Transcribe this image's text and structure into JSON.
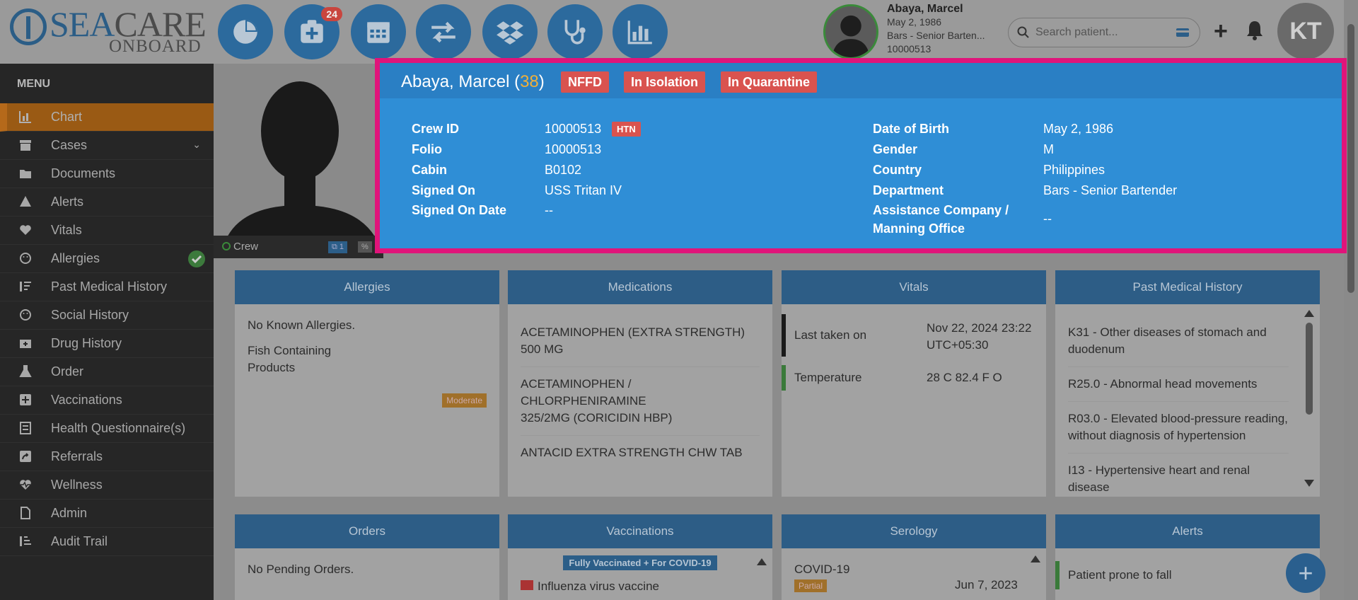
{
  "logo": {
    "sea": "SEA",
    "care": "CARE",
    "onboard": "ONBOARD"
  },
  "nav": {
    "badge_count": "24"
  },
  "patient_top": {
    "name": "Abaya, Marcel",
    "dob": "May 2, 1986",
    "dept": "Bars - Senior Barten...",
    "id": "10000513"
  },
  "search": {
    "placeholder": "Search patient..."
  },
  "user": {
    "initials": "KT"
  },
  "menu": {
    "header": "MENU",
    "items": [
      "Chart",
      "Cases",
      "Documents",
      "Alerts",
      "Vitals",
      "Allergies",
      "Past Medical History",
      "Social History",
      "Drug History",
      "Order",
      "Vaccinations",
      "Health Questionnaire(s)",
      "Referrals",
      "Wellness",
      "Admin",
      "Audit Trail"
    ]
  },
  "photo": {
    "status": "Crew",
    "count": "1"
  },
  "summary": {
    "name": "Abaya, Marcel (",
    "age": "38",
    "close": ")",
    "tags": [
      "NFFD",
      "In Isolation",
      "In Quarantine"
    ],
    "left": [
      {
        "label": "Crew ID",
        "value": "10000513"
      },
      {
        "label": "Folio",
        "value": "10000513"
      },
      {
        "label": "Cabin",
        "value": "B0102"
      },
      {
        "label": "Signed On",
        "value": "USS Tritan IV"
      },
      {
        "label": "Signed On Date",
        "value": "--"
      }
    ],
    "htn": "HTN",
    "right": [
      {
        "label": "Date of Birth",
        "value": "May 2, 1986"
      },
      {
        "label": "Gender",
        "value": "M"
      },
      {
        "label": "Country",
        "value": "Philippines"
      },
      {
        "label": "Department",
        "value": "Bars - Senior Bartender"
      },
      {
        "label": "Assistance Company /",
        "label2": "Manning Office",
        "value": "--"
      }
    ]
  },
  "cards": {
    "allergies": {
      "title": "Allergies",
      "none": "No Known Allergies.",
      "item1": "Fish Containing",
      "item2": "Products",
      "severity": "Moderate"
    },
    "medications": {
      "title": "Medications",
      "m1a": "ACETAMINOPHEN (EXTRA STRENGTH)",
      "m1b": "500 MG",
      "m2a": "ACETAMINOPHEN / CHLORPHENIRAMINE",
      "m2b": "325/2MG (CORICIDIN HBP)",
      "m3": "ANTACID EXTRA STRENGTH CHW TAB"
    },
    "vitals": {
      "title": "Vitals",
      "last_label": "Last taken on",
      "last_value1": "Nov 22, 2024 23:22",
      "last_value2": "UTC+05:30",
      "temp_label": "Temperature",
      "temp_value": "28 C    82.4 F    O"
    },
    "pmh": {
      "title": "Past Medical History",
      "i1a": "K31 - Other diseases of stomach and",
      "i1b": "duodenum",
      "i2": "R25.0 - Abnormal head movements",
      "i3a": "R03.0 - Elevated blood-pressure reading,",
      "i3b": "without diagnosis of hypertension",
      "i4a": "I13 - Hypertensive heart and renal",
      "i4b": "disease"
    },
    "orders": {
      "title": "Orders",
      "none": "No Pending Orders."
    },
    "vaccinations": {
      "title": "Vaccinations",
      "badge": "Fully Vaccinated + For COVID-19",
      "item": "Influenza virus vaccine"
    },
    "serology": {
      "title": "Serology",
      "item": "COVID-19",
      "status": "Partial",
      "date": "Jun 7, 2023"
    },
    "alerts": {
      "title": "Alerts",
      "item": "Patient prone to fall"
    }
  },
  "fab": {
    "label": "+"
  }
}
